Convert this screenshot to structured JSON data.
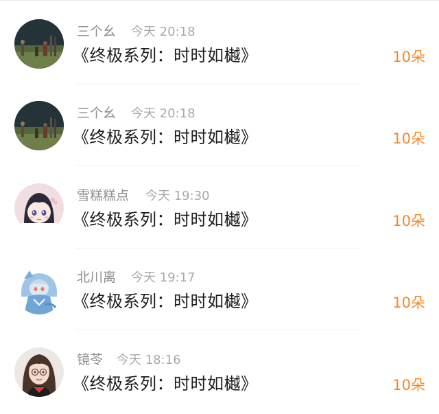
{
  "feed": {
    "items": [
      {
        "user": "三个幺",
        "time": "今天 20:18",
        "title": "《终极系列：时时如樾》",
        "gift": "10朵",
        "avatar_icon": "night-field-figures-avatar"
      },
      {
        "user": "三个幺",
        "time": "今天 20:18",
        "title": "《终极系列：时时如樾》",
        "gift": "10朵",
        "avatar_icon": "night-field-figures-avatar"
      },
      {
        "user": "雪糕糕点",
        "time": "今天 19:30",
        "title": "《终极系列：时时如樾》",
        "gift": "10朵",
        "avatar_icon": "anime-girl-avatar"
      },
      {
        "user": "北川离",
        "time": "今天 19:17",
        "title": "《终极系列：时时如樾》",
        "gift": "10朵",
        "avatar_icon": "anime-shark-hoodie-avatar"
      },
      {
        "user": "镜苓",
        "time": "今天 18:16",
        "title": "《终极系列：时时如樾》",
        "gift": "10朵",
        "avatar_icon": "woman-glasses-avatar"
      }
    ]
  },
  "colors": {
    "gift": "#f28a2c",
    "username": "#8e8e8e",
    "time": "#a9a9a9",
    "title": "#1c1c1c",
    "divider": "#f0f0f0"
  }
}
